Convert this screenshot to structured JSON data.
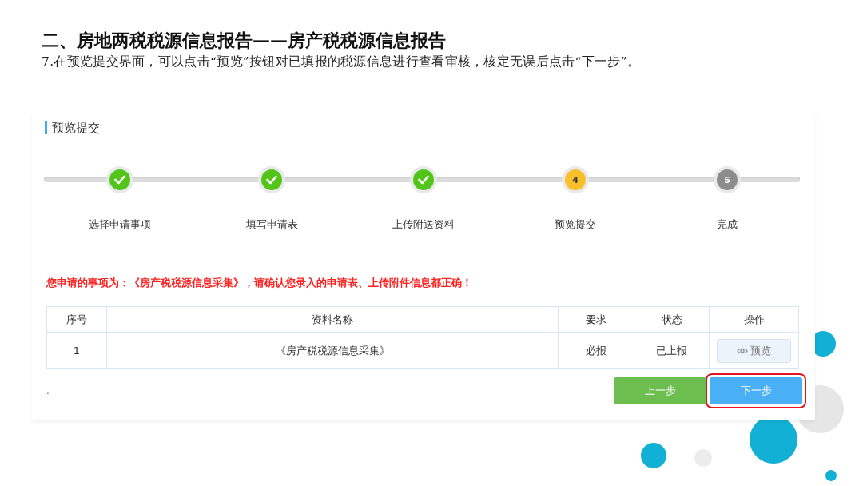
{
  "slide": {
    "title": "二、房地两税税源信息报告——房产税税源信息报告",
    "subtitle": "7.在预览提交界面，可以点击“预览”按钮对已填报的税源信息进行查看审核，核定无误后点击“下一步”。"
  },
  "panel": {
    "heading": "预览提交",
    "steps": [
      {
        "label": "选择申请事项",
        "kind": "done"
      },
      {
        "label": "填写申请表",
        "kind": "done"
      },
      {
        "label": "上传附送资料",
        "kind": "done"
      },
      {
        "number": "4",
        "label": "预览提交",
        "kind": "current"
      },
      {
        "number": "5",
        "label": "完成",
        "kind": "pending"
      }
    ],
    "notice": "您申请的事项为：《房产税税源信息采集》，请确认您录入的申请表、上传附件信息都正确！",
    "table": {
      "columns": [
        "序号",
        "资料名称",
        "要求",
        "状态",
        "操作"
      ],
      "rows": [
        {
          "index": "1",
          "name": "《房产税税源信息采集》",
          "requirement": "必报",
          "status": "已上报",
          "action": "预览"
        }
      ]
    },
    "footnote": ".",
    "buttons": [
      {
        "label": "上一步",
        "kind": "secondary",
        "highlighted": false
      },
      {
        "label": "下一步",
        "kind": "primary",
        "highlighted": true
      }
    ]
  }
}
